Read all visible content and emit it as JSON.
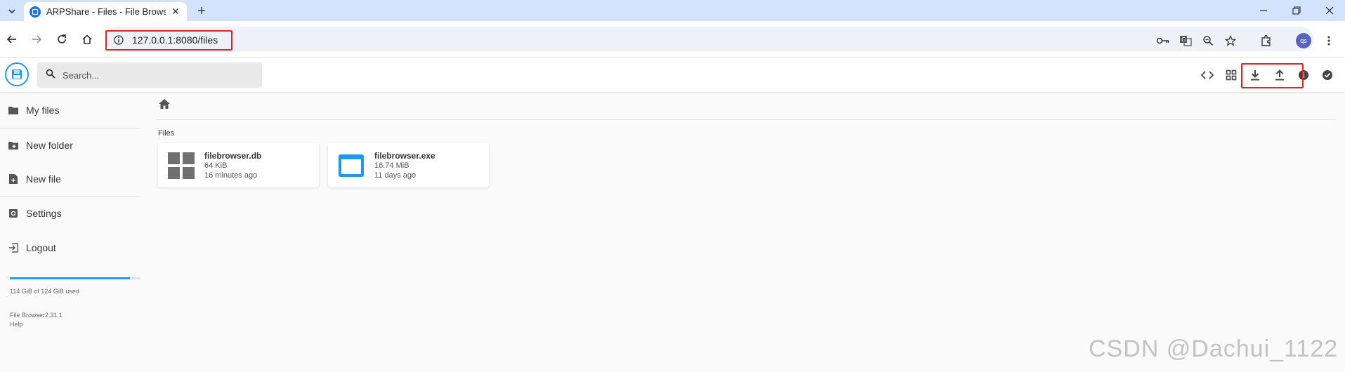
{
  "browser": {
    "tab": {
      "title": "ARPShare - Files - File Browser"
    },
    "url": "127.0.0.1:8080/files",
    "profile_initials": "qs"
  },
  "app": {
    "search": {
      "placeholder": "Search..."
    }
  },
  "sidebar": {
    "items": [
      {
        "label": "My files",
        "icon": "folder-icon"
      },
      {
        "label": "New folder",
        "icon": "create-new-folder-icon"
      },
      {
        "label": "New file",
        "icon": "note-add-icon"
      },
      {
        "label": "Settings",
        "icon": "settings-icon"
      },
      {
        "label": "Logout",
        "icon": "exit-icon"
      }
    ],
    "usage": {
      "text": "114 GiB of 124 GiB used",
      "fraction": 0.919
    },
    "version": "File Browser2.31.1",
    "help": "Help"
  },
  "main": {
    "section_title": "Files",
    "files": [
      {
        "name": "filebrowser.db",
        "size": "64 KiB",
        "modified": "16 minutes ago",
        "icon": "grid-icon"
      },
      {
        "name": "filebrowser.exe",
        "size": "16.74 MiB",
        "modified": "11 days ago",
        "icon": "application-window-icon"
      }
    ]
  },
  "colors": {
    "accent": "#2196f3",
    "highlight": "#e52222",
    "tabstrip": "#d3e3fd"
  },
  "watermark": "CSDN @Dachui_1122"
}
